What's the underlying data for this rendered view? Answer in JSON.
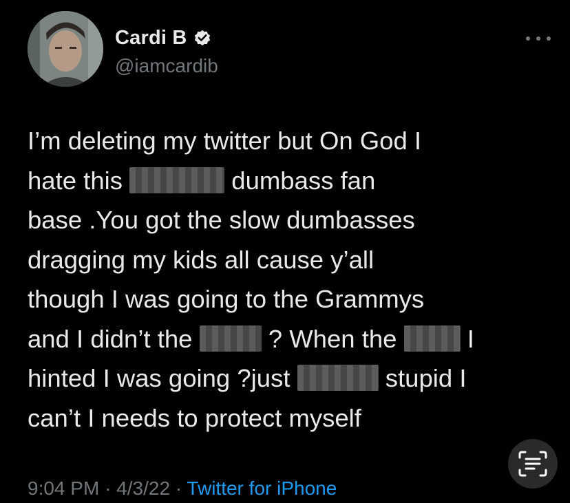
{
  "tweet": {
    "author": {
      "display_name": "Cardi B",
      "handle": "@iamcardib",
      "verified": true
    },
    "more_icon": "more-horizontal-icon",
    "lines": [
      [
        "I’m deleting my twitter but On God I"
      ],
      [
        "hate this",
        "dumbass fan"
      ],
      [
        "base .You got the slow dumbasses"
      ],
      [
        "dragging my kids all cause y’all"
      ],
      [
        "though I was going to the Grammys"
      ],
      [
        "and I didn’t the",
        "? When the",
        "I"
      ],
      [
        "hinted I was going ?just",
        "stupid I"
      ],
      [
        "can’t I needs to protect myself"
      ]
    ],
    "time": "9:04 PM",
    "separator": "·",
    "date": "4/3/22",
    "source": "Twitter for iPhone"
  },
  "overlay": {
    "live_text_icon": "live-text-icon"
  },
  "colors": {
    "background": "#000000",
    "text": "#e7e9ea",
    "secondary": "#71767b",
    "link": "#1d9bf0"
  }
}
